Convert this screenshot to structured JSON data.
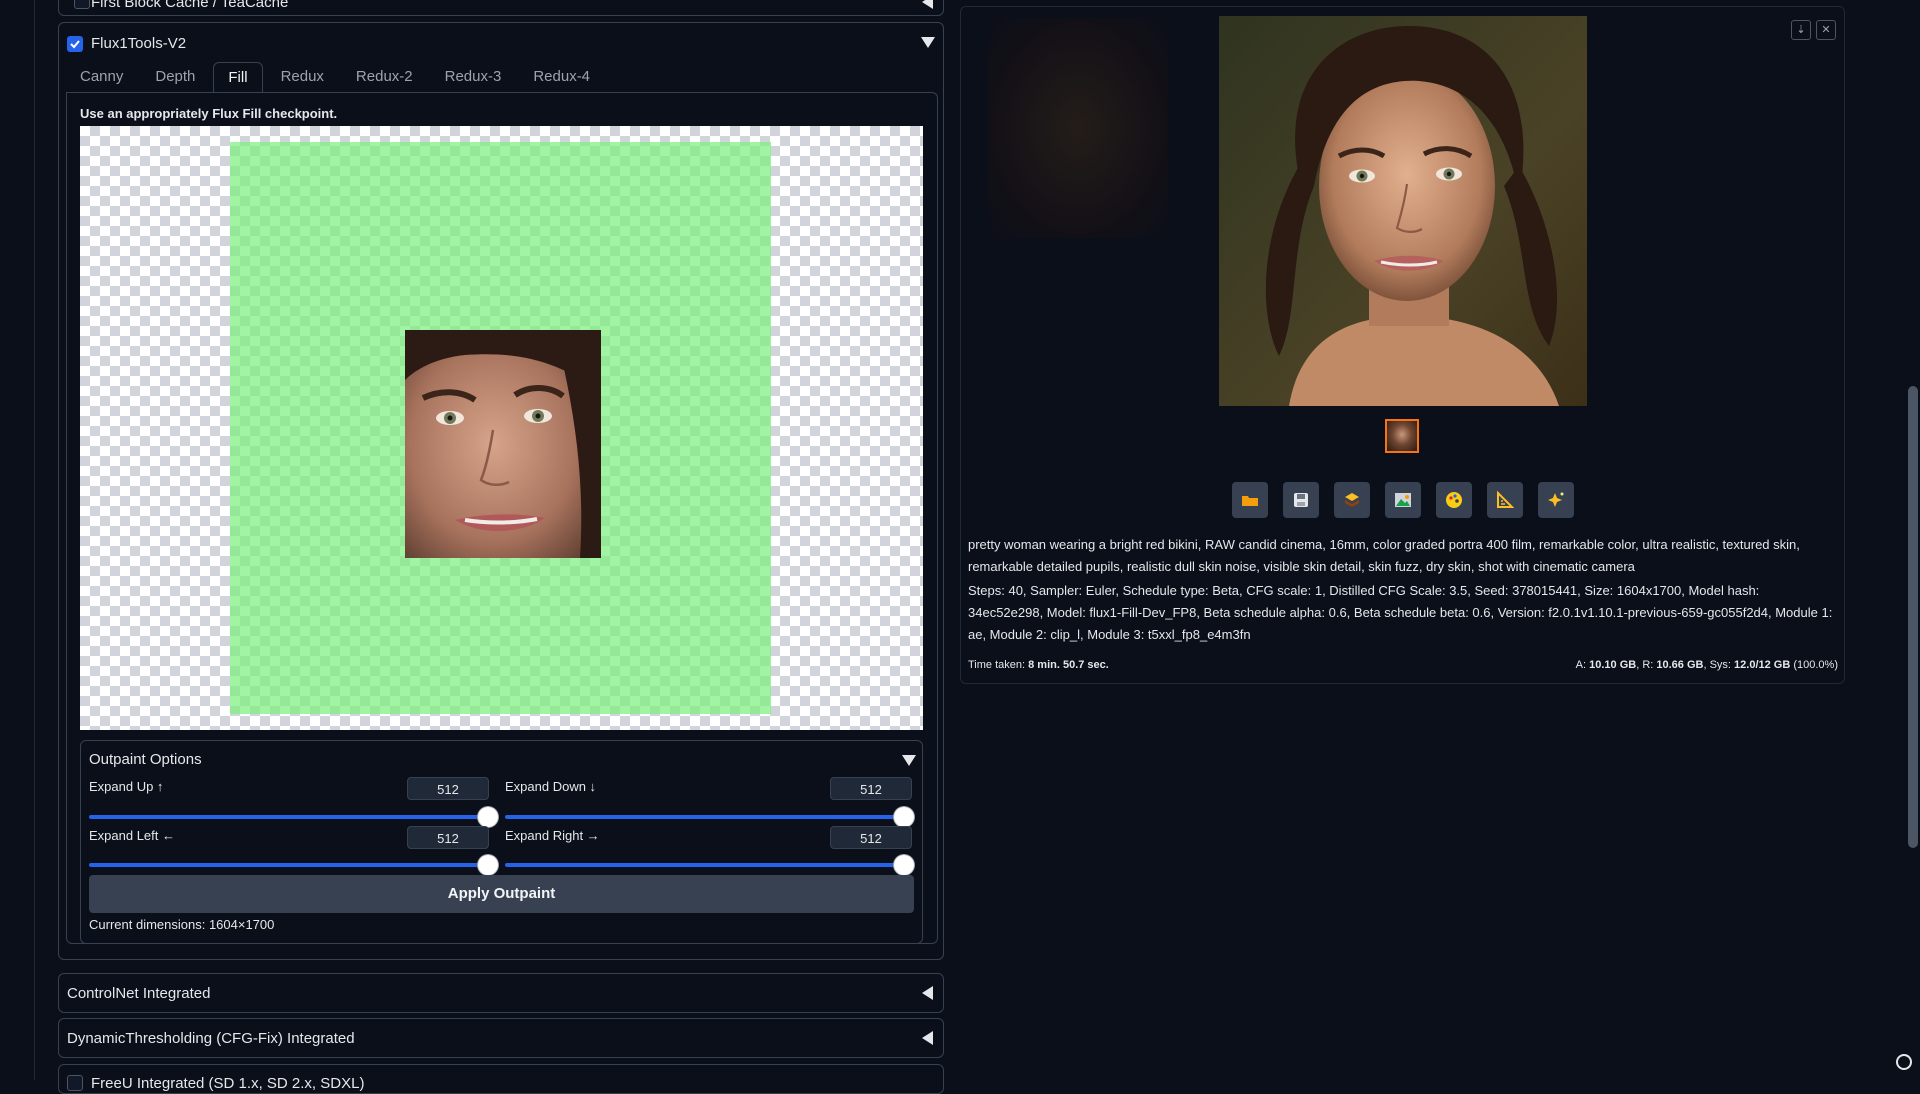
{
  "accordions": {
    "first_block_cache": "First Block Cache / TeaCache",
    "flux_tools": "Flux1Tools-V2",
    "controlnet": "ControlNet Integrated",
    "dynamic_thresholding": "DynamicThresholding (CFG-Fix) Integrated",
    "partial_bottom": "FreeU Integrated (SD 1.x, SD 2.x, SDXL)"
  },
  "tabs": [
    "Canny",
    "Depth",
    "Fill",
    "Redux",
    "Redux-2",
    "Redux-3",
    "Redux-4"
  ],
  "active_tab": "Fill",
  "fill_hint": "Use an appropriately Flux Fill checkpoint.",
  "outpaint": {
    "title": "Outpaint Options",
    "expand_up_label": "Expand Up ↑",
    "expand_up_value": "512",
    "expand_down_label": "Expand Down ↓",
    "expand_down_value": "512",
    "expand_left_label": "Expand Left ←",
    "expand_left_value": "512",
    "expand_right_label": "Expand Right →",
    "expand_right_value": "512",
    "slider_levels": {
      "up": 1.0,
      "down": 1.0,
      "left": 1.0,
      "right": 1.0
    },
    "apply_label": "Apply Outpaint",
    "current_dimensions": "Current dimensions: 1604×1700"
  },
  "output": {
    "prompt": "pretty woman wearing a bright red bikini, RAW candid cinema, 16mm, color graded portra 400 film, remarkable color, ultra realistic, textured skin, remarkable detailed pupils, realistic dull skin noise, visible skin detail, skin fuzz, dry skin, shot with cinematic camera",
    "params": "Steps: 40, Sampler: Euler, Schedule type: Beta, CFG scale: 1, Distilled CFG Scale: 3.5, Seed: 378015441, Size: 1604x1700, Model hash: 34ec52e298, Model: flux1-Fill-Dev_FP8, Beta schedule alpha: 0.6, Beta schedule beta: 0.6, Version: f2.0.1v1.10.1-previous-659-gc055f2d4, Module 1: ae, Module 2: clip_l, Module 3: t5xxl_fp8_e4m3fn",
    "time_label": "Time taken: ",
    "time_value": "8 min. 50.7 sec.",
    "mem_a_label": "A: ",
    "mem_a": "10.10 GB",
    "mem_r_label": ", R: ",
    "mem_r": "10.66 GB",
    "mem_sys_label": ", Sys: ",
    "mem_sys": "12.0/12 GB",
    "mem_pct": " (100.0%)"
  },
  "toolbar_icons": [
    "folder-icon",
    "save-icon",
    "zip-icon",
    "image-icon",
    "palette-icon",
    "ruler-icon",
    "sparkle-icon"
  ],
  "colors": {
    "accent": "#2563eb",
    "background": "#0b0f19",
    "border": "#374151",
    "mask_green": "#7df07d"
  }
}
